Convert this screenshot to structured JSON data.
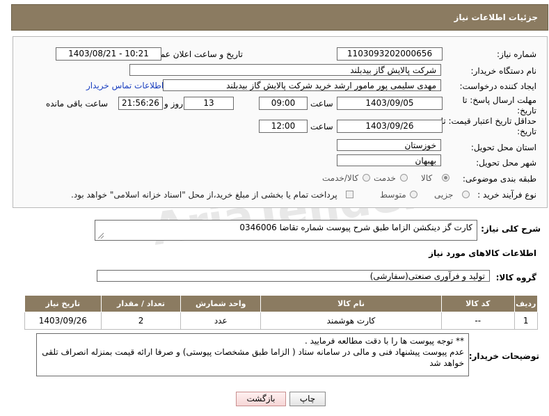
{
  "header": {
    "title": "جزئیات اطلاعات نیاز"
  },
  "form": {
    "need_number_label": "شماره نیاز:",
    "need_number": "1103093202000656",
    "announce_label": "تاریخ و ساعت اعلان عمومی:",
    "announce_value": "1403/08/21 - 10:21",
    "buyer_org_label": "نام دستگاه خریدار:",
    "buyer_org": "شرکت پالایش گاز بیدبلند",
    "creator_label": "ایجاد کننده درخواست:",
    "creator": "مهدی سلیمی پور مامور ارشد خرید شرکت پالایش گاز بیدبلند",
    "contact_link": "اطلاعات تماس خریدار",
    "deadline_label_1": "مهلت ارسال پاسخ: تا",
    "deadline_label_2": "تاریخ:",
    "deadline_date": "1403/09/05",
    "time_label": "ساعت",
    "deadline_time": "09:00",
    "days_value": "13",
    "days_label": "روز و",
    "remaining_time": "21:56:26",
    "remaining_label": "ساعت باقی مانده",
    "validity_label_1": "حداقل تاریخ اعتبار قیمت: تا",
    "validity_label_2": "تاریخ:",
    "validity_date": "1403/09/26",
    "validity_time": "12:00",
    "province_label": "استان محل تحویل:",
    "province": "خوزستان",
    "city_label": "شهر محل تحویل:",
    "city": "بهبهان",
    "category_label": "طبقه بندی موضوعی:",
    "category_options": [
      "کالا",
      "خدمت",
      "کالا/خدمت"
    ],
    "category_selected": "کالا",
    "process_label": "نوع فرآیند خرید :",
    "process_options": [
      "جزیی",
      "متوسط"
    ],
    "payment_note": "پرداخت تمام یا بخشی از مبلغ خرید،از محل \"اسناد خزانه اسلامی\" خواهد بود."
  },
  "description": {
    "label": "شرح کلی نیاز:",
    "text": "کارت گز دینکشن الزاما طبق شرح پیوست شماره تقاضا  0346006"
  },
  "goods_info": {
    "title": "اطلاعات کالاهای مورد نیاز",
    "group_label": "گروه کالا:",
    "group_value": "تولید و فرآوری صنعتی(سفارشی)"
  },
  "table": {
    "headers": [
      "ردیف",
      "کد کالا",
      "نام کالا",
      "واحد شمارش",
      "تعداد / مقدار",
      "تاریخ نیاز"
    ],
    "rows": [
      [
        "1",
        "--",
        "کارت هوشمند",
        "عدد",
        "2",
        "1403/09/26"
      ]
    ]
  },
  "buyer_notes": {
    "label": "توضیحات خریدار:",
    "line1": "** توجه پیوست ها  را با دقت مطالعه فرمایید .",
    "line2": "عدم پیوست پیشنهاد فنی و مالی در سامانه ستاد ( الزاما طبق مشخصات پیوستی)  و صرفا ارائه قیمت بمنزله انصراف تلقی",
    "line3": "خواهد شد"
  },
  "buttons": {
    "print": "چاپ",
    "back": "بازگشت"
  },
  "watermark": "AriaTender.net"
}
